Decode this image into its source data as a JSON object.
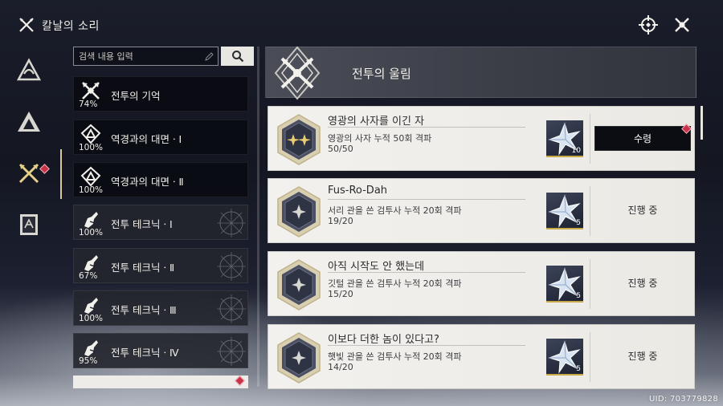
{
  "window": {
    "title": "칼날의 소리"
  },
  "search": {
    "placeholder": "검색 내용 입력",
    "value": ""
  },
  "rail": {
    "items": [
      {
        "name": "rail-item-triangle-swirl",
        "icon": "triangle-swirl-icon",
        "active": false
      },
      {
        "name": "rail-item-triangle-peak",
        "icon": "triangle-peak-icon",
        "active": false
      },
      {
        "name": "rail-item-crossed-blades",
        "icon": "crossed-blades-icon",
        "active": true,
        "badge": "!"
      },
      {
        "name": "rail-item-card",
        "icon": "card-icon",
        "active": false
      }
    ]
  },
  "list": {
    "items": [
      {
        "label": "전투의 기억",
        "percent": "74%",
        "icon": "crossed-swords-icon"
      },
      {
        "label": "역경과의 대면ㆍⅠ",
        "percent": "100%",
        "icon": "shield-triangle-icon"
      },
      {
        "label": "역경과의 대면ㆍⅡ",
        "percent": "100%",
        "icon": "shield-triangle-icon"
      },
      {
        "label": "전투 테크닉ㆍⅠ",
        "percent": "100%",
        "icon": "fist-blade-icon"
      },
      {
        "label": "전투 테크닉ㆍⅡ",
        "percent": "67%",
        "icon": "fist-blade-icon"
      },
      {
        "label": "전투 테크닉ㆍⅢ",
        "percent": "100%",
        "icon": "fist-blade-icon"
      },
      {
        "label": "전투 테크닉ㆍⅣ",
        "percent": "95%",
        "icon": "fist-blade-icon"
      }
    ],
    "partial_badge": "!"
  },
  "header": {
    "title": "전투의 울림",
    "emblem": "crossed-blades-emblem-icon"
  },
  "achievements": [
    {
      "title": "영광의 사자를 이긴 자",
      "desc": "영광의 사자 누적 50회 격파",
      "progress": "50/50",
      "reward_count": "10",
      "status": "수령",
      "claimable": true,
      "badge": "!",
      "emblem": "twin-stars-icon"
    },
    {
      "title": "Fus-Ro-Dah",
      "desc": "서리 관을 쓴 검투사 누적 20회 격파",
      "progress": "19/20",
      "reward_count": "5",
      "status": "진행 중",
      "claimable": false,
      "emblem": "star-icon"
    },
    {
      "title": "아직 시작도 안 했는데",
      "desc": "깃털 관을 쓴 검투사 누적 20회 격파",
      "progress": "15/20",
      "reward_count": "5",
      "status": "진행 중",
      "claimable": false,
      "emblem": "star-icon"
    },
    {
      "title": "이보다 더한 놈이 있다고?",
      "desc": "햇빛 관을 쓴 검투사 누적 20회 격파",
      "progress": "14/20",
      "reward_count": "5",
      "status": "진행 중",
      "claimable": false,
      "emblem": "star-icon"
    }
  ],
  "footer": {
    "uid": "UID: 703779828"
  },
  "colors": {
    "accent_gold": "#d9c99a",
    "badge_red": "#c8324a",
    "card_bg": "#f2f1ee"
  }
}
